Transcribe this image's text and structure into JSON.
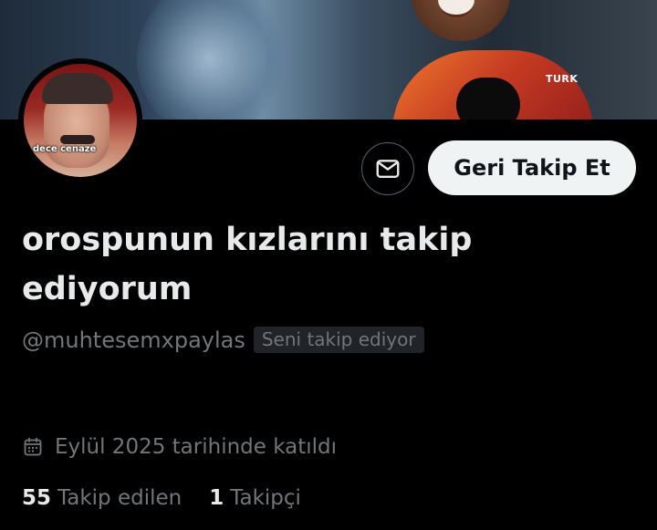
{
  "profile": {
    "display_name": "orospunun kızlarını takip ediyorum",
    "handle": "@muhtesemxpaylas",
    "follows_you_badge": "Seni takip ediyor",
    "avatar_caption": "dece cenaze",
    "joined": "Eylül 2025 tarihinde katıldı",
    "following_count": "55",
    "following_label": "Takip edilen",
    "followers_count": "1",
    "followers_label": "Takipçi"
  },
  "banner": {
    "jersey_text": "TURK"
  },
  "actions": {
    "message_icon": "envelope-icon",
    "follow_back_label": "Geri Takip Et"
  },
  "icons": {
    "joined_icon": "calendar-icon"
  },
  "colors": {
    "background": "#000000",
    "primary_text": "#e7e9ea",
    "secondary_text": "#71767b",
    "button_bg": "#eff3f4",
    "badge_bg": "#202327",
    "border": "#536471"
  }
}
